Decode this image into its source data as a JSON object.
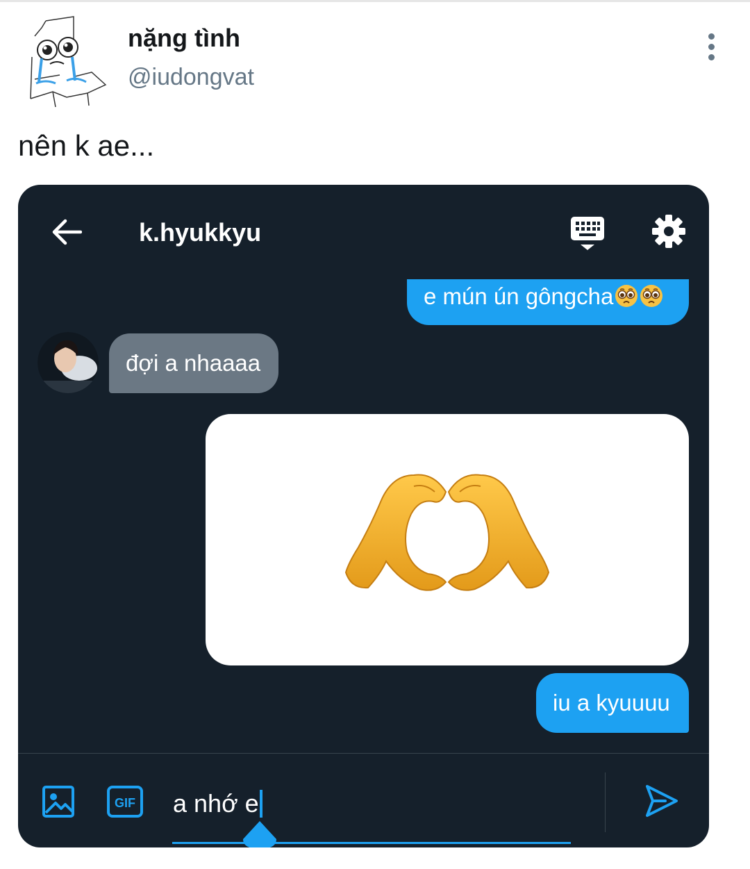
{
  "tweet": {
    "display_name": "nặng tình",
    "handle": "@iudongvat",
    "text": "nên k ae..."
  },
  "dm_screenshot": {
    "chat_title": "k.hyukkyu",
    "messages": [
      {
        "side": "sent",
        "text": "e mún ún gôngcha",
        "emoji": [
          "pleading-face",
          "pleading-face"
        ]
      },
      {
        "side": "received",
        "text": "đợi a nhaaaa"
      },
      {
        "side": "sent",
        "type": "image",
        "content": "heart-hands-emoji"
      },
      {
        "side": "sent",
        "text": "iu a kyuuuu"
      }
    ],
    "composer": {
      "value": "a nhớ e"
    }
  },
  "colors": {
    "accent": "#1da1f2",
    "card_bg": "#15202b",
    "received_bubble": "#6b7884",
    "handle_text": "#657786"
  }
}
